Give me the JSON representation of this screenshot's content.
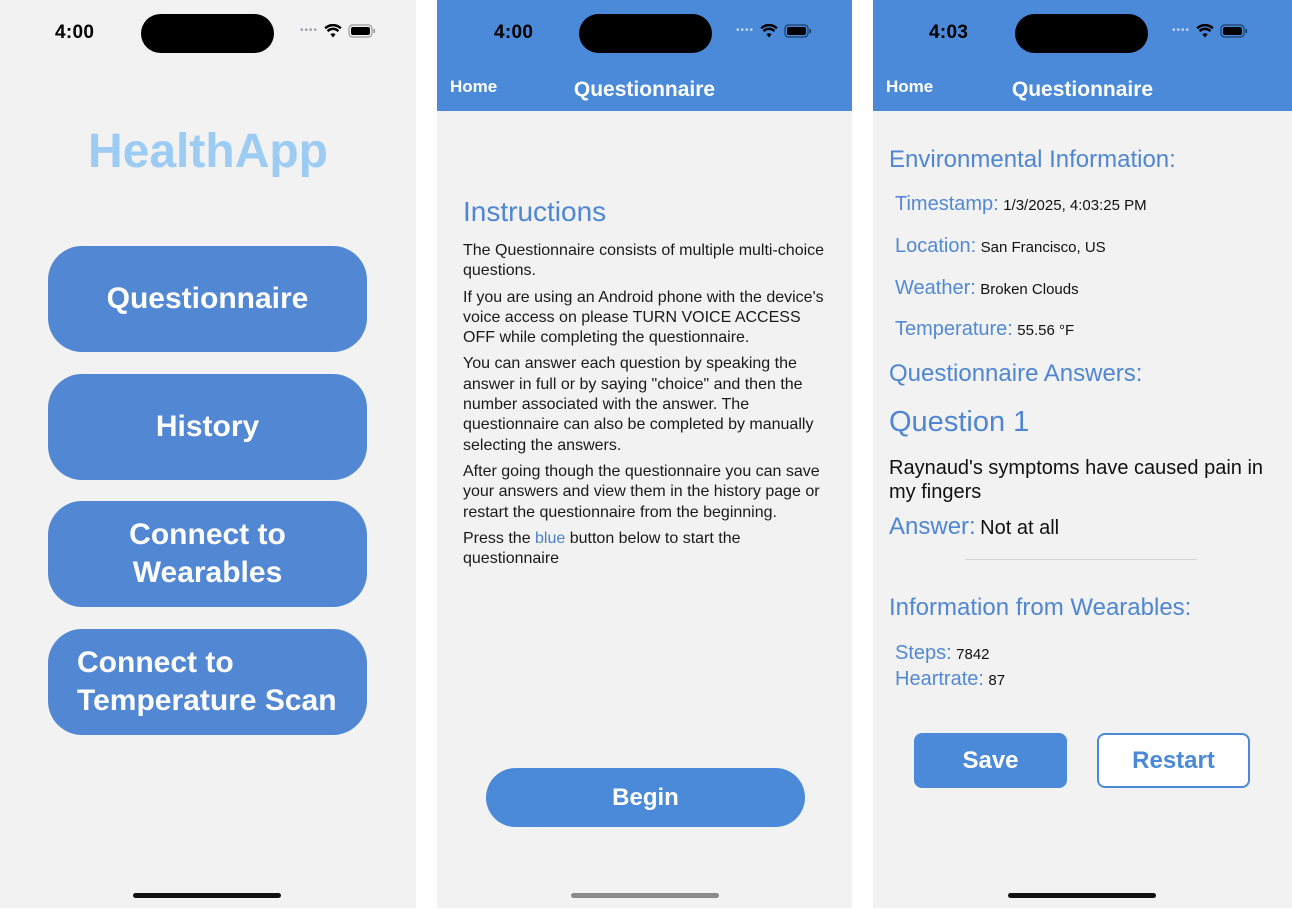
{
  "screen1": {
    "status_time": "4:00",
    "app_title": "HealthApp",
    "buttons": [
      "Questionnaire",
      "History",
      "Connect to Wearables",
      "Connect to Temperature Scan"
    ]
  },
  "screen2": {
    "status_time": "4:00",
    "nav_home": "Home",
    "nav_title": "Questionnaire",
    "instructions_title": "Instructions",
    "paragraphs": [
      "The Questionnaire consists of multiple multi-choice questions.",
      "If you are using an Android phone with the device's voice access on please TURN VOICE ACCESS OFF while completing the questionnaire.",
      "You can answer each question by speaking the answer in full or by saying \"choice\" and then the number associated with the answer. The questionnaire can also be completed by manually selecting the answers.",
      "After going though the questionnaire you can save your answers and view them in the history page or restart the questionnaire from the beginning."
    ],
    "last_paragraph": {
      "before": "Press the ",
      "highlight": "blue",
      "after": " button below to start the questionnaire"
    },
    "begin_button": "Begin",
    "accent_color": "#4a8ad8"
  },
  "screen3": {
    "status_time": "4:03",
    "nav_home": "Home",
    "nav_title": "Questionnaire",
    "env_heading": "Environmental Information:",
    "env": {
      "timestamp_label": "Timestamp:",
      "timestamp_value": "1/3/2025, 4:03:25 PM",
      "location_label": "Location:",
      "location_value": "San Francisco, US",
      "weather_label": "Weather:",
      "weather_value": "Broken Clouds",
      "temperature_label": "Temperature:",
      "temperature_value": "55.56 °F"
    },
    "answers_heading": "Questionnaire Answers:",
    "question_title": "Question 1",
    "question_text": "Raynaud's symptoms have caused pain in my fingers",
    "answer_label": "Answer:",
    "answer_value": "Not at all",
    "wearables_heading": "Information from Wearables:",
    "wearables": {
      "steps_label": "Steps:",
      "steps_value": "7842",
      "heartrate_label": "Heartrate:",
      "heartrate_value": "87"
    },
    "save_button": "Save",
    "restart_button": "Restart"
  },
  "icons": [
    "signal-dots-icon",
    "wifi-icon",
    "battery-icon"
  ]
}
